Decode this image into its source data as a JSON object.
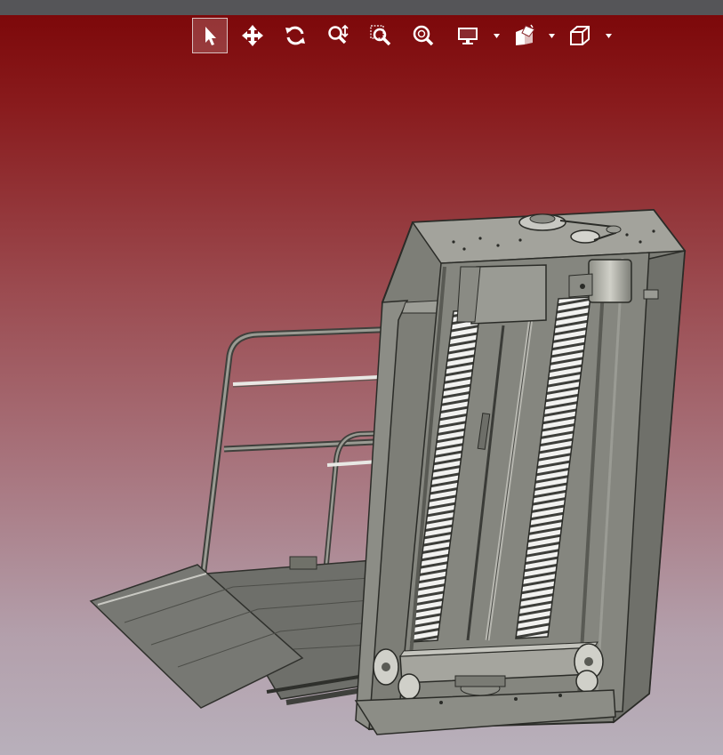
{
  "toolbar": {
    "buttons": [
      {
        "name": "select-tool-button",
        "icon": "cursor-arrow-icon",
        "active": true
      },
      {
        "name": "pan-tool-button",
        "icon": "move-arrows-icon",
        "active": false
      },
      {
        "name": "rotate-tool-button",
        "icon": "rotate-icon",
        "active": false
      },
      {
        "name": "zoom-tool-button",
        "icon": "zoom-in-out-icon",
        "active": false
      },
      {
        "name": "zoom-window-button",
        "icon": "zoom-window-icon",
        "active": false
      },
      {
        "name": "zoom-fit-button",
        "icon": "zoom-fit-icon",
        "active": false
      },
      {
        "name": "display-mode-button",
        "icon": "monitor-icon",
        "active": false,
        "dropdown": true
      },
      {
        "name": "section-view-button",
        "icon": "section-box-icon",
        "active": false,
        "dropdown": true
      },
      {
        "name": "view-orientation-button",
        "icon": "cube-icon",
        "active": false,
        "dropdown": true
      }
    ],
    "icon_color": "#ffffff"
  },
  "viewport": {
    "background_top": "#7b0507",
    "background_bottom": "#b8b0bb",
    "model": "vertical-platform-lift-assembly"
  }
}
